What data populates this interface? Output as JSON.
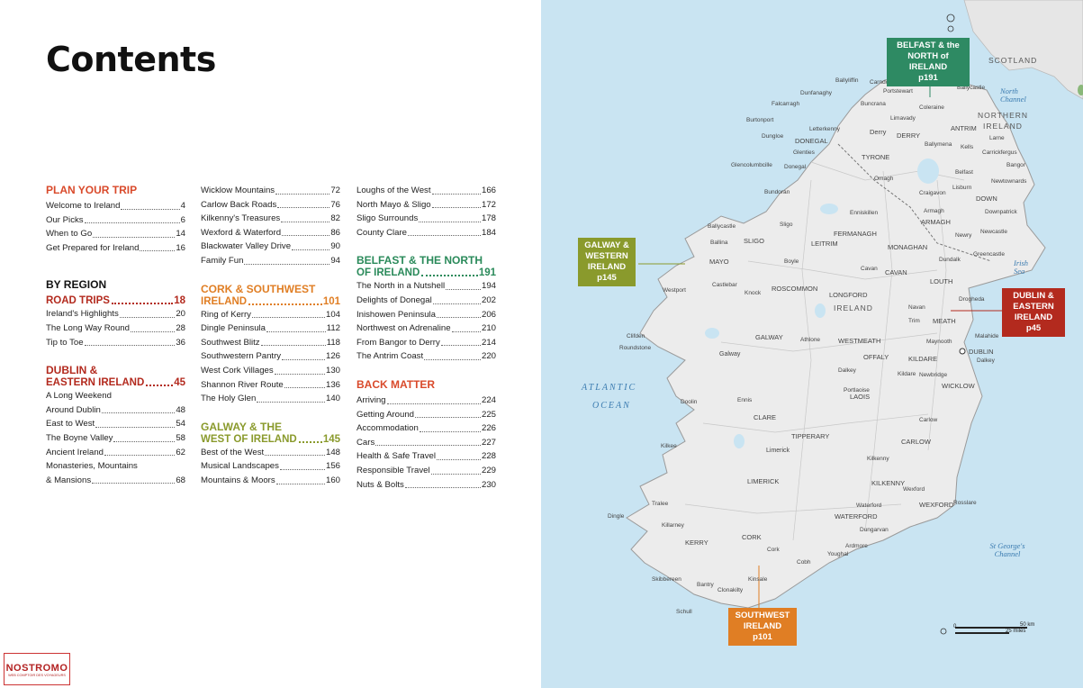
{
  "title": "Contents",
  "col1": {
    "plan": {
      "heading": "PLAN YOUR TRIP",
      "entries": [
        {
          "label": "Welcome to Ireland",
          "page": "4"
        },
        {
          "label": "Our Picks",
          "page": "6"
        },
        {
          "label": "When to Go",
          "page": "14"
        },
        {
          "label": "Get Prepared for Ireland",
          "page": "16"
        }
      ]
    },
    "by_region": "BY REGION",
    "road": {
      "heading": "ROAD TRIPS",
      "page": "18",
      "entries": [
        {
          "label": "Ireland's Highlights",
          "page": "20"
        },
        {
          "label": "The Long Way Round",
          "page": "28"
        },
        {
          "label": "Tip to Toe",
          "page": "36"
        }
      ]
    },
    "dublin": {
      "heading1": "DUBLIN &",
      "heading2": "EASTERN IRELAND",
      "page": "45",
      "entries": [
        {
          "label": "A Long Weekend",
          "page": ""
        },
        {
          "label": "Around Dublin",
          "page": "48"
        },
        {
          "label": "East to West",
          "page": "54"
        },
        {
          "label": "The Boyne Valley",
          "page": "58"
        },
        {
          "label": "Ancient Ireland",
          "page": "62"
        },
        {
          "label": "Monasteries, Mountains",
          "page": ""
        },
        {
          "label": "& Mansions",
          "page": "68"
        }
      ]
    }
  },
  "col2": {
    "entries_top": [
      {
        "label": "Wicklow Mountains",
        "page": "72"
      },
      {
        "label": "Carlow Back Roads",
        "page": "76"
      },
      {
        "label": "Kilkenny's Treasures",
        "page": "82"
      },
      {
        "label": "Wexford & Waterford",
        "page": "86"
      },
      {
        "label": "Blackwater Valley Drive",
        "page": "90"
      },
      {
        "label": "Family Fun",
        "page": "94"
      }
    ],
    "cork": {
      "heading1": "CORK & SOUTHWEST",
      "heading2": "IRELAND",
      "page": "101",
      "entries": [
        {
          "label": "Ring of Kerry",
          "page": "104"
        },
        {
          "label": "Dingle Peninsula",
          "page": "112"
        },
        {
          "label": "Southwest Blitz",
          "page": "118"
        },
        {
          "label": "Southwestern Pantry",
          "page": "126"
        },
        {
          "label": "West Cork Villages",
          "page": "130"
        },
        {
          "label": "Shannon River Route",
          "page": "136"
        },
        {
          "label": "The Holy Glen",
          "page": "140"
        }
      ]
    },
    "galway": {
      "heading1": "GALWAY & THE",
      "heading2": "WEST OF IRELAND",
      "page": "145",
      "entries": [
        {
          "label": "Best of the West",
          "page": "148"
        },
        {
          "label": "Musical Landscapes",
          "page": "156"
        },
        {
          "label": "Mountains & Moors",
          "page": "160"
        }
      ]
    }
  },
  "col3": {
    "entries_top": [
      {
        "label": "Loughs of the West",
        "page": "166"
      },
      {
        "label": "North Mayo & Sligo",
        "page": "172"
      },
      {
        "label": "Sligo Surrounds",
        "page": "178"
      },
      {
        "label": "County Clare",
        "page": "184"
      }
    ],
    "belfast": {
      "heading1": "BELFAST & THE NORTH",
      "heading2": "OF IRELAND",
      "page": "191",
      "entries": [
        {
          "label": "The North in a Nutshell",
          "page": "194"
        },
        {
          "label": "Delights of Donegal",
          "page": "202"
        },
        {
          "label": "Inishowen Peninsula",
          "page": "206"
        },
        {
          "label": "Northwest on Adrenaline",
          "page": "210"
        },
        {
          "label": "From Bangor to Derry",
          "page": "214"
        },
        {
          "label": "The Antrim Coast",
          "page": "220"
        }
      ]
    },
    "back": {
      "heading": "BACK MATTER",
      "entries": [
        {
          "label": "Arriving",
          "page": "224"
        },
        {
          "label": "Getting Around",
          "page": "225"
        },
        {
          "label": "Accommodation",
          "page": "226"
        },
        {
          "label": "Cars",
          "page": "227"
        },
        {
          "label": "Health & Safe Travel",
          "page": "228"
        },
        {
          "label": "Responsible Travel",
          "page": "229"
        },
        {
          "label": "Nuts & Bolts",
          "page": "230"
        }
      ]
    }
  },
  "logo": {
    "name": "NOSTROMO",
    "tag": "WEB COMPTOIR DES VOYAGEURS"
  },
  "map": {
    "callouts": {
      "belfast": [
        "BELFAST & the",
        "NORTH of IRELAND",
        "p191"
      ],
      "galway": [
        "GALWAY &",
        "WESTERN",
        "IRELAND",
        "p145"
      ],
      "dublin": [
        "DUBLIN &",
        "EASTERN",
        "IRELAND",
        "p45"
      ],
      "south": [
        "SOUTHWEST",
        "IRELAND",
        "p101"
      ]
    },
    "regions": [
      "SCOTLAND",
      "NORTHERN",
      "IRELAND",
      "IRELAND"
    ],
    "seas": {
      "north_channel": "North Channel",
      "irish_sea": "Irish Sea",
      "atlantic": "ATLANTIC",
      "ocean": "OCEAN",
      "st_georges": "St George's Channel"
    },
    "scale": {
      "km": "50 km",
      "miles": "25 miles",
      "zero": "0"
    },
    "counties": [
      "DONEGAL",
      "ANTRIM",
      "DERRY",
      "TYRONE",
      "ARMAGH",
      "DOWN",
      "FERMANAGH",
      "MONAGHAN",
      "LOUTH",
      "CAVAN",
      "LEITRIM",
      "SLIGO",
      "MAYO",
      "ROSCOMMON",
      "LONGFORD",
      "MEATH",
      "WESTMEATH",
      "OFFALY",
      "KILDARE",
      "DUBLIN",
      "GALWAY",
      "LAOIS",
      "WICKLOW",
      "CLARE",
      "TIPPERARY",
      "CARLOW",
      "KILKENNY",
      "WEXFORD",
      "LIMERICK",
      "WATERFORD",
      "KERRY",
      "CORK"
    ],
    "towns": [
      "Ballyliffin",
      "Carndonagh",
      "Portstewart",
      "Ballycastle",
      "Dunfanaghy",
      "Buncrana",
      "Coleraine",
      "Falcarragh",
      "Limavady",
      "Burtonport",
      "Letterkenny",
      "Dungloe",
      "Derry",
      "Ballymena",
      "Kells",
      "Larne",
      "Glenties",
      "Carrickfergus",
      "Glencolumbcille",
      "Donegal",
      "Omagh",
      "Belfast",
      "Bangor",
      "Bundoran",
      "Lisburn",
      "Newtownards",
      "Craigavon",
      "Enniskillen",
      "Ballycastle",
      "Sligo",
      "Armagh",
      "Downpatrick",
      "Ballina",
      "Newry",
      "Newcastle",
      "Boyle",
      "Dundalk",
      "Greencastle",
      "Castlebar",
      "Westport",
      "Knock",
      "Drogheda",
      "Navan",
      "Trim",
      "Malahide",
      "Cavan",
      "Clifden",
      "Roundstone",
      "Galway",
      "Athlone",
      "Maynooth",
      "Dublin",
      "Dalkey",
      "Tullamore",
      "Kildare",
      "Newbridge",
      "Doolin",
      "Ennis",
      "Portlaoise",
      "Kilkee",
      "Limerick",
      "Carlow",
      "Kilkenny",
      "Tralee",
      "Killarney",
      "Dungarvan",
      "Waterford",
      "Wexford",
      "Rosslare",
      "Kinsale",
      "Bantry",
      "Skibbereen",
      "Cobh",
      "Cork",
      "Schull",
      "Youghal",
      "Ardmore",
      "Clonakilty",
      "Dingle"
    ]
  }
}
